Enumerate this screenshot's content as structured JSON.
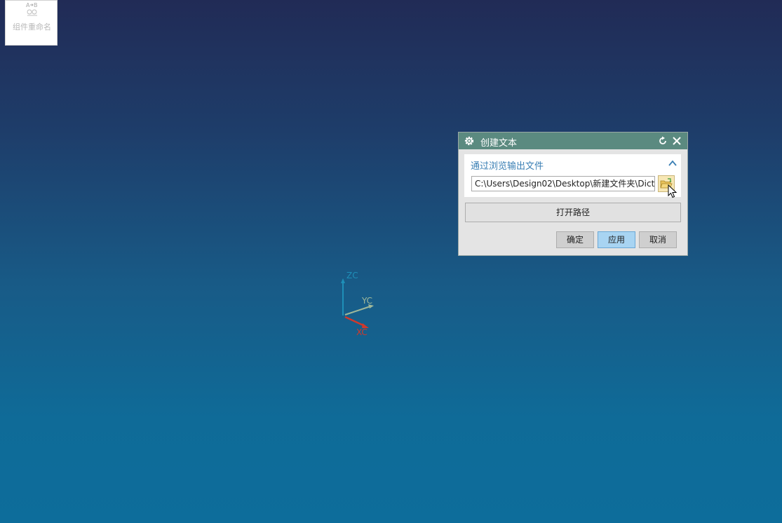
{
  "toolbar": {
    "rename_component_label": "组件重命名",
    "rename_component_icon": "rename-component-icon"
  },
  "triad": {
    "zc_label": "ZC",
    "yc_label": "YC",
    "xc_label": "XC",
    "colors": {
      "zc": "#1e8fb8",
      "yc": "#9fb89a",
      "xc": "#d0392b"
    }
  },
  "dialog": {
    "title": "创建文本",
    "title_icon": "gear-icon",
    "reset_icon": "reset-icon",
    "close_icon": "close-icon",
    "group": {
      "title": "通过浏览输出文件",
      "collapse_icon": "chevron-up-icon",
      "path_value": "C:\\Users\\Design02\\Desktop\\新建文件夹\\Dict",
      "browse_icon": "folder-open-icon"
    },
    "open_path_label": "打开路径",
    "buttons": {
      "ok": "确定",
      "apply": "应用",
      "cancel": "取消"
    },
    "colors": {
      "title_bar": "#5b8a80",
      "group_title": "#3a7fb4",
      "apply_button": "#a8d4f2"
    }
  }
}
